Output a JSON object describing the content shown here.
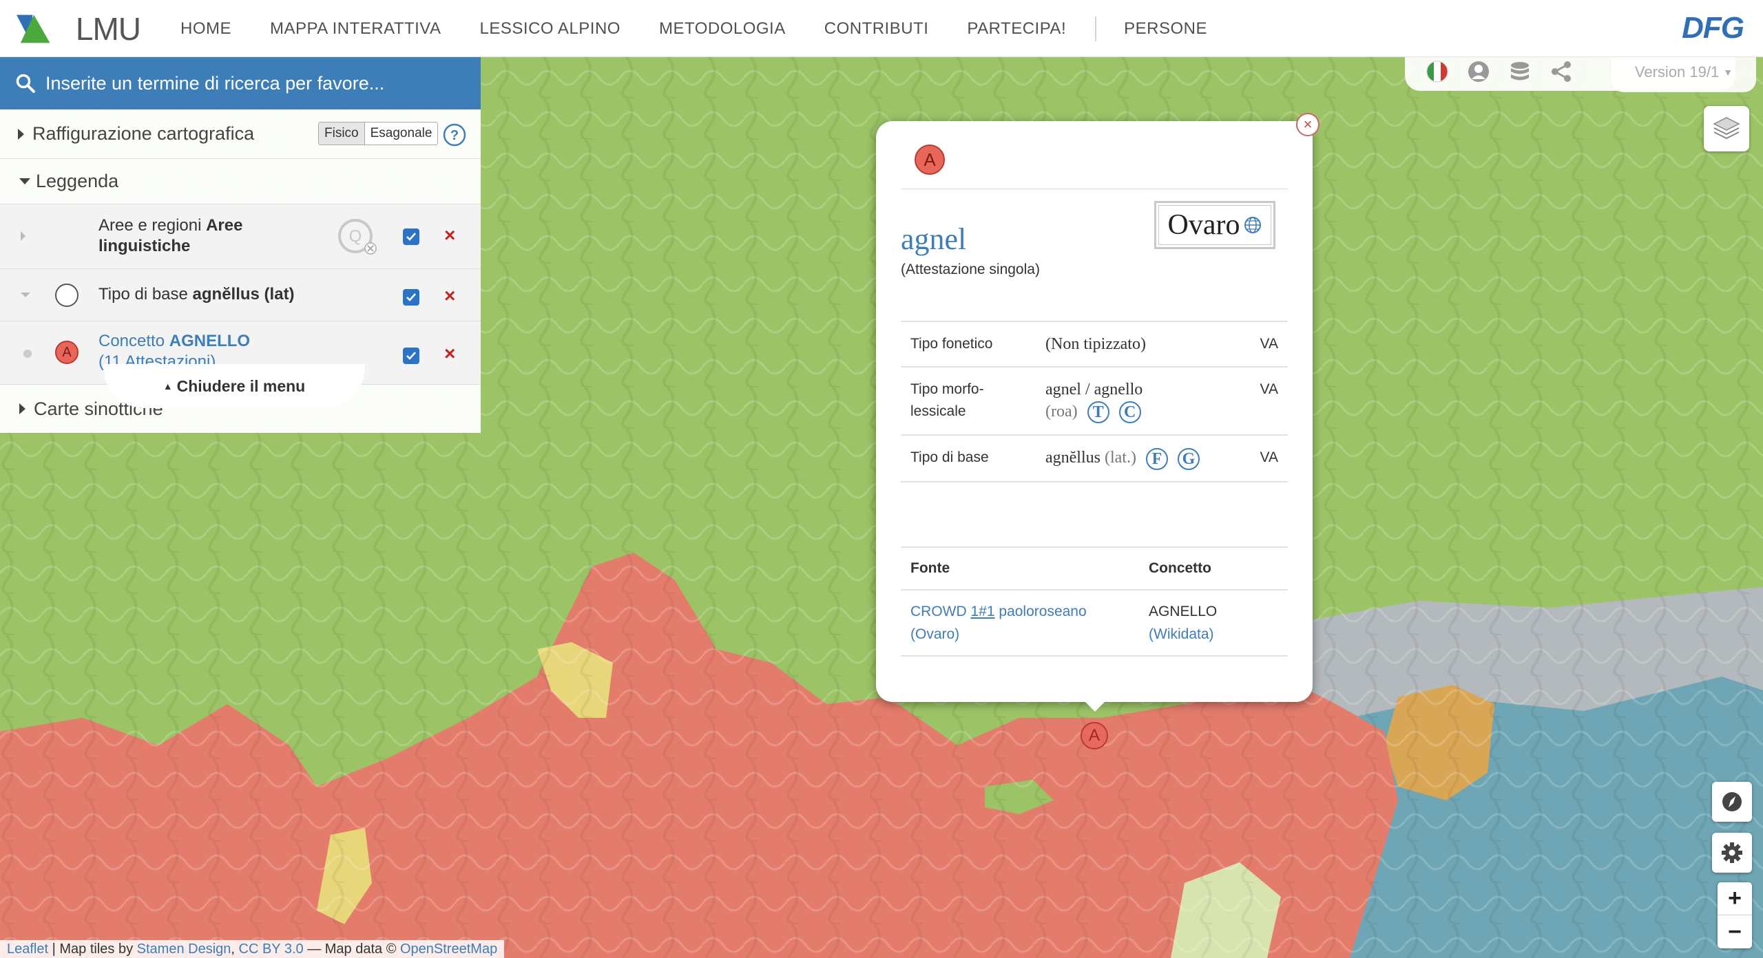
{
  "header": {
    "logo_text": "LMU",
    "nav": [
      "HOME",
      "MAPPA INTERATTIVA",
      "LESSICO ALPINO",
      "METODOLOGIA",
      "CONTRIBUTI",
      "PARTECIPA!",
      "PERSONE"
    ],
    "sponsor": "DFG"
  },
  "toolbar": {
    "icons": [
      "italian-flag-icon",
      "user-icon",
      "database-icon",
      "share-icon"
    ],
    "version": "Version 19/1"
  },
  "search": {
    "placeholder": "Inserite un termine di ricerca per favore..."
  },
  "panel": {
    "raffigurazione": "Raffigurazione cartografica",
    "toggle": [
      "Fisico",
      "Esagonale"
    ],
    "leggenda": "Leggenda",
    "legend_items": [
      {
        "prefix": "Aree e regioni ",
        "bold": "Aree",
        "rest": "linguistiche",
        "checked": true
      },
      {
        "prefix": "Tipo di base ",
        "bold": "agnĕllus (lat)",
        "checked": true
      },
      {
        "prefix": "Concetto ",
        "bold": "AGNELLO",
        "count": "(11 Attestazioni)",
        "checked": true,
        "marker": "A"
      }
    ],
    "carte": "Carte sinottiche",
    "close_menu": "Chiudere il menu"
  },
  "popup": {
    "marker": "A",
    "word": "agnel",
    "subtitle": "(Attestazione singola)",
    "place": "Ovaro",
    "rows": [
      {
        "label": "Tipo fonetico",
        "value": "(Non tipizzato)",
        "source": "VA"
      },
      {
        "label": "Tipo morfo-lessicale",
        "value": "agnel / agnello",
        "lang": "(roa)",
        "buttons": [
          "T",
          "C"
        ],
        "source": "VA"
      },
      {
        "label": "Tipo di base",
        "value": "agnĕllus",
        "lang": "(lat.)",
        "buttons": [
          "F",
          "G"
        ],
        "source": "VA"
      }
    ],
    "source_headers": [
      "Fonte",
      "Concetto"
    ],
    "source_row": {
      "fonte_prefix": "CROWD",
      "fonte_id": "1#1",
      "fonte_user": "paoloroseano",
      "fonte_place": "(Ovaro)",
      "concetto": "AGNELLO",
      "concetto_link": "(Wikidata)"
    }
  },
  "map_marker": "A",
  "attribution": {
    "leaflet": "Leaflet",
    "tiles_text": " | Map tiles by ",
    "stamen": "Stamen Design",
    "comma": ", ",
    "cc": "CC BY 3.0",
    "osm_text": " — Map data © ",
    "osm": "OpenStreetMap"
  },
  "colors": {
    "accent": "#3d7db8",
    "marker_red": "#e8665a",
    "region_green": "#9cc466",
    "region_red": "#e47c6c",
    "region_blue": "#6fa6b6"
  }
}
